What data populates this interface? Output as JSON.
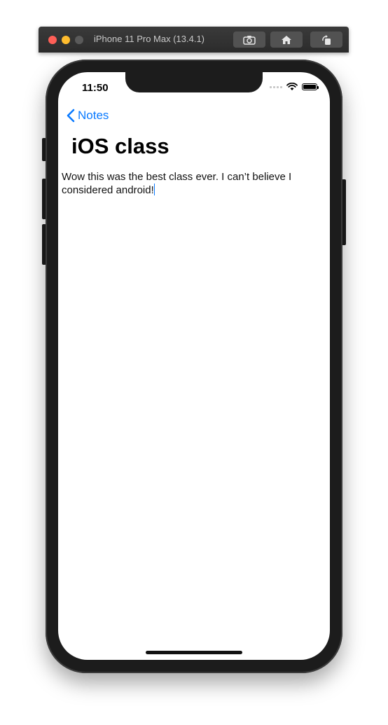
{
  "window": {
    "title": "iPhone 11 Pro Max (13.4.1)",
    "buttons": [
      "screenshot-icon",
      "home-icon",
      "rotate-icon"
    ]
  },
  "status_bar": {
    "time": "11:50"
  },
  "nav": {
    "back_label": "Notes"
  },
  "note": {
    "title": "iOS class",
    "body": "Wow this was the best class ever.  I can’t believe I considered android!"
  },
  "colors": {
    "accent": "#0a7aff",
    "device": "#1c1c1c",
    "traffic_red": "#fe5f57",
    "traffic_yellow": "#febc2e"
  }
}
